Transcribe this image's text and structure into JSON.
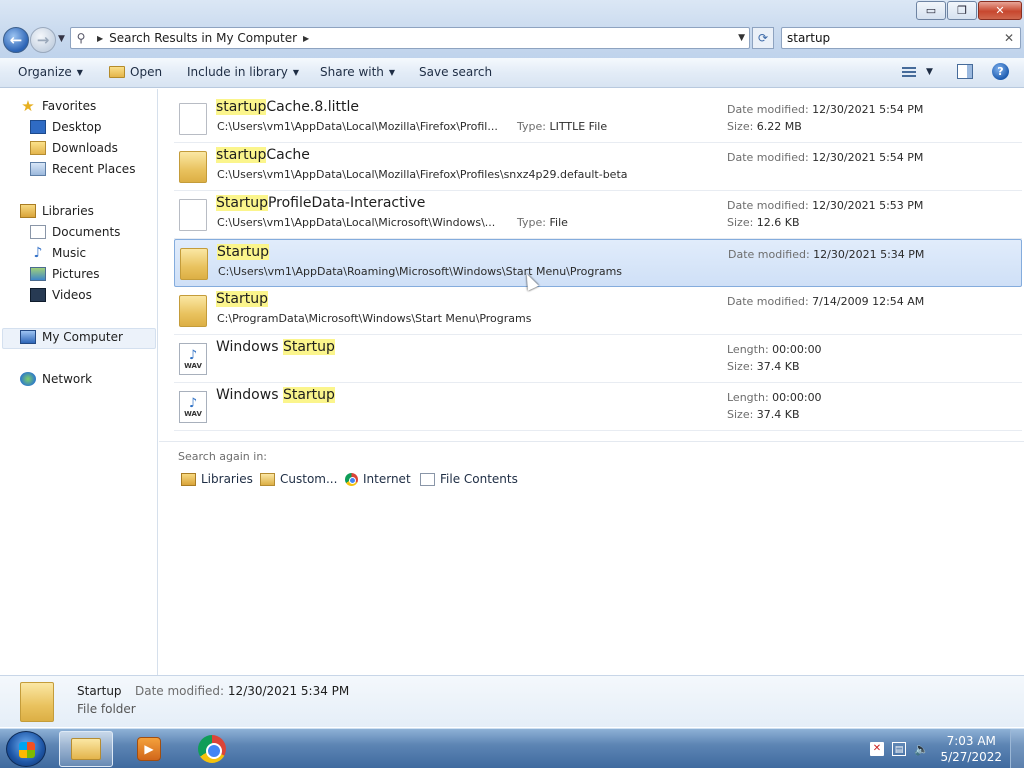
{
  "window": {
    "controls": {
      "minimize": "▭",
      "maximize": "❐",
      "close": "✕"
    }
  },
  "navigation": {
    "back_icon": "back-arrow-icon",
    "forward_icon": "forward-arrow-icon",
    "address_crumb": "Search Results in My Computer",
    "search_value": "startup"
  },
  "toolbar": {
    "organize": "Organize",
    "open": "Open",
    "include_in_library": "Include in library",
    "share_with": "Share with",
    "save_search": "Save search"
  },
  "sidebar": {
    "favorites": "Favorites",
    "desktop": "Desktop",
    "downloads": "Downloads",
    "recent_places": "Recent Places",
    "libraries": "Libraries",
    "documents": "Documents",
    "music": "Music",
    "pictures": "Pictures",
    "videos": "Videos",
    "my_computer": "My Computer",
    "network": "Network"
  },
  "results": [
    {
      "name_highlight": "startup",
      "name_rest": "Cache.8.little",
      "name_prefix": "",
      "path": "C:\\Users\\vm1\\AppData\\Local\\Mozilla\\Firefox\\Profil...",
      "type_label": "Type:",
      "type_value": "LITTLE File",
      "meta1_label": "Date modified:",
      "meta1_value": "12/30/2021 5:54 PM",
      "meta2_label": "Size:",
      "meta2_value": "6.22 MB"
    },
    {
      "name_highlight": "startup",
      "name_rest": "Cache",
      "name_prefix": "",
      "path": "C:\\Users\\vm1\\AppData\\Local\\Mozilla\\Firefox\\Profiles\\snxz4p29.default-beta",
      "meta1_label": "Date modified:",
      "meta1_value": "12/30/2021 5:54 PM"
    },
    {
      "name_highlight": "Startup",
      "name_rest": "ProfileData-Interactive",
      "name_prefix": "",
      "path": "C:\\Users\\vm1\\AppData\\Local\\Microsoft\\Windows\\...",
      "type_label": "Type:",
      "type_value": "File",
      "meta1_label": "Date modified:",
      "meta1_value": "12/30/2021 5:53 PM",
      "meta2_label": "Size:",
      "meta2_value": "12.6 KB"
    },
    {
      "name_highlight": "Startup",
      "name_rest": "",
      "name_prefix": "",
      "path": "C:\\Users\\vm1\\AppData\\Roaming\\Microsoft\\Windows\\Start Menu\\Programs",
      "meta1_label": "Date modified:",
      "meta1_value": "12/30/2021 5:34 PM"
    },
    {
      "name_highlight": "Startup",
      "name_rest": "",
      "name_prefix": "",
      "path": "C:\\ProgramData\\Microsoft\\Windows\\Start Menu\\Programs",
      "meta1_label": "Date modified:",
      "meta1_value": "7/14/2009 12:54 AM"
    },
    {
      "name_prefix": "Windows ",
      "name_highlight": "Startup",
      "name_rest": "",
      "path": "",
      "meta1_label": "Length:",
      "meta1_value": "00:00:00",
      "meta2_label": "Size:",
      "meta2_value": "37.4 KB"
    },
    {
      "name_prefix": "Windows ",
      "name_highlight": "Startup",
      "name_rest": "",
      "path": "",
      "meta1_label": "Length:",
      "meta1_value": "00:00:00",
      "meta2_label": "Size:",
      "meta2_value": "37.4 KB"
    }
  ],
  "search_again": {
    "label": "Search again in:",
    "libraries": "Libraries",
    "custom": "Custom...",
    "internet": "Internet",
    "file_contents": "File Contents"
  },
  "details": {
    "name": "Startup",
    "type": "File folder",
    "date_label": "Date modified:",
    "date_value": "12/30/2021 5:34 PM"
  },
  "taskbar": {
    "time": "7:03 AM",
    "date": "5/27/2022"
  }
}
